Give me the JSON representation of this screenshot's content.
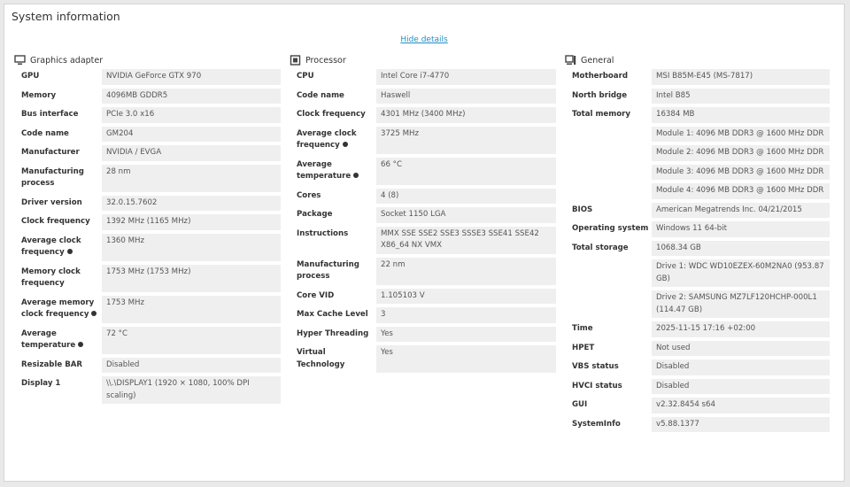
{
  "window": {
    "title": "System information",
    "hide_details": "Hide details"
  },
  "graphics": {
    "header": "Graphics adapter",
    "icon": "monitor-icon",
    "rows": [
      {
        "label": "GPU",
        "value": "NVIDIA GeForce GTX 970"
      },
      {
        "label": "Memory",
        "value": "4096MB GDDR5"
      },
      {
        "label": "Bus interface",
        "value": "PCIe 3.0 x16"
      },
      {
        "label": "Code name",
        "value": "GM204"
      },
      {
        "label": "Manufacturer",
        "value": "NVIDIA / EVGA"
      },
      {
        "label": "Manufacturing process",
        "value": "28 nm"
      },
      {
        "label": "Driver version",
        "value": "32.0.15.7602"
      },
      {
        "label": "Clock frequency",
        "value": "1392 MHz (1165 MHz)"
      },
      {
        "label": "Average clock frequency",
        "value": "1360 MHz",
        "info": true
      },
      {
        "label": "Memory clock frequency",
        "value": "1753 MHz (1753 MHz)"
      },
      {
        "label": "Average memory clock frequency",
        "value": "1753 MHz",
        "info": true
      },
      {
        "label": "Average temperature",
        "value": "72 °C",
        "info": true
      },
      {
        "label": "Resizable BAR",
        "value": "Disabled"
      },
      {
        "label": "Display 1",
        "value": "\\\\.\\DISPLAY1 (1920 × 1080, 100% DPI scaling)"
      }
    ]
  },
  "processor": {
    "header": "Processor",
    "icon": "chip-icon",
    "rows": [
      {
        "label": "CPU",
        "value": "Intel Core i7-4770"
      },
      {
        "label": "Code name",
        "value": "Haswell"
      },
      {
        "label": "Clock frequency",
        "value": "4301 MHz (3400 MHz)"
      },
      {
        "label": "Average clock frequency",
        "value": "3725 MHz",
        "info": true
      },
      {
        "label": "Average temperature",
        "value": "66 °C",
        "info": true
      },
      {
        "label": "Cores",
        "value": "4 (8)"
      },
      {
        "label": "Package",
        "value": "Socket 1150 LGA"
      },
      {
        "label": "Instructions",
        "value": "MMX SSE SSE2 SSE3 SSSE3 SSE41 SSE42 X86_64 NX VMX"
      },
      {
        "label": "Manufacturing process",
        "value": "22 nm"
      },
      {
        "label": "Core VID",
        "value": "1.105103 V"
      },
      {
        "label": "Max Cache Level",
        "value": "3"
      },
      {
        "label": "Hyper Threading",
        "value": "Yes"
      },
      {
        "label": "Virtual Technology",
        "value": "Yes"
      }
    ]
  },
  "general": {
    "header": "General",
    "icon": "computer-icon",
    "rows": [
      {
        "label": "Motherboard",
        "value": "MSI B85M-E45 (MS-7817)"
      },
      {
        "label": "North bridge",
        "value": "Intel B85"
      },
      {
        "label": "Total memory",
        "value": "16384 MB"
      },
      {
        "label": "",
        "value": "Module 1: 4096 MB DDR3 @ 1600 MHz DDR"
      },
      {
        "label": "",
        "value": "Module 2: 4096 MB DDR3 @ 1600 MHz DDR"
      },
      {
        "label": "",
        "value": "Module 3: 4096 MB DDR3 @ 1600 MHz DDR"
      },
      {
        "label": "",
        "value": "Module 4: 4096 MB DDR3 @ 1600 MHz DDR"
      },
      {
        "label": "BIOS",
        "value": "American Megatrends Inc. 04/21/2015"
      },
      {
        "label": "Operating system",
        "value": "Windows 11 64-bit"
      },
      {
        "label": "Total storage",
        "value": "1068.34 GB"
      },
      {
        "label": "",
        "value": "Drive 1: WDC WD10EZEX-60M2NA0 (953.87 GB)"
      },
      {
        "label": "",
        "value": "Drive 2: SAMSUNG MZ7LF120HCHP-000L1 (114.47 GB)"
      },
      {
        "label": "Time",
        "value": "2025-11-15 17:16 +02:00"
      },
      {
        "label": "HPET",
        "value": "Not used"
      },
      {
        "label": "VBS status",
        "value": "Disabled"
      },
      {
        "label": "HVCI status",
        "value": "Disabled"
      },
      {
        "label": "GUI",
        "value": "v2.32.8454 s64"
      },
      {
        "label": "SystemInfo",
        "value": "v5.88.1377"
      }
    ]
  }
}
